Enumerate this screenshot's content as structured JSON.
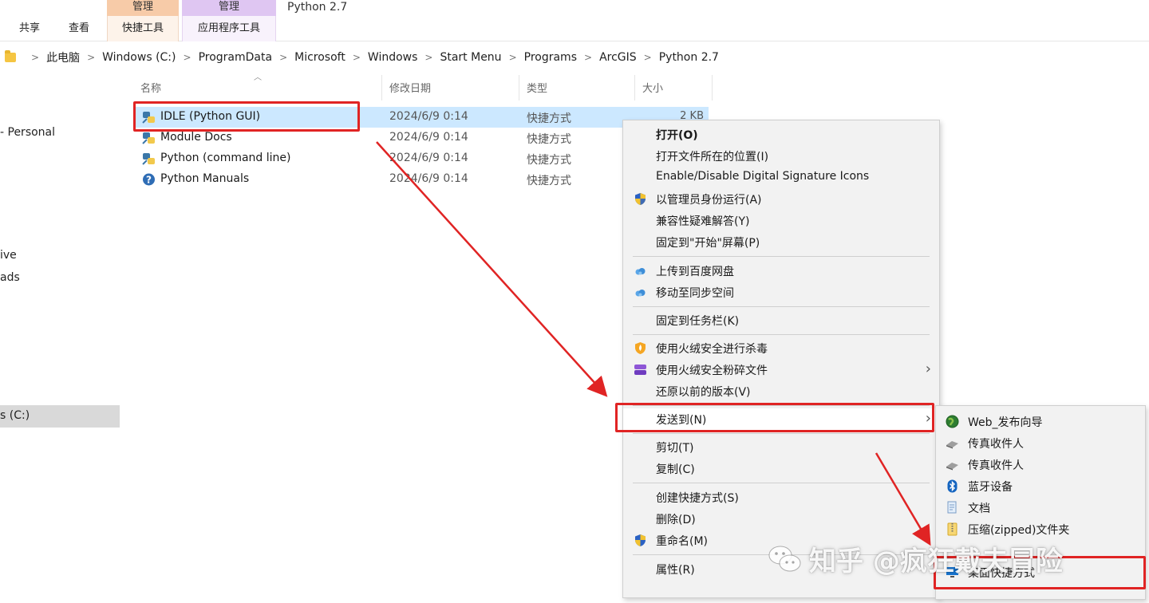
{
  "ribbon": {
    "tabs": [
      "共享",
      "查看"
    ],
    "context_groups": [
      {
        "header": "管理",
        "tab": "快捷工具"
      },
      {
        "header": "管理",
        "tab": "应用程序工具"
      }
    ],
    "window_title": "Python 2.7"
  },
  "address": {
    "crumbs": [
      "此电脑",
      "Windows (C:)",
      "ProgramData",
      "Microsoft",
      "Windows",
      "Start Menu",
      "Programs",
      "ArcGIS",
      "Python 2.7"
    ],
    "separator": ">"
  },
  "nav": {
    "fragments": [
      "- Personal",
      "ive",
      "ads",
      "s (C:)"
    ]
  },
  "columns": {
    "name": "名称",
    "date": "修改日期",
    "type": "类型",
    "size": "大小"
  },
  "files": [
    {
      "name": "IDLE (Python GUI)",
      "date": "2024/6/9 0:14",
      "type": "快捷方式",
      "size": "2 KB",
      "icon": "python-icon"
    },
    {
      "name": "Module Docs",
      "date": "2024/6/9 0:14",
      "type": "快捷方式",
      "size": "",
      "icon": "python-icon"
    },
    {
      "name": "Python (command line)",
      "date": "2024/6/9 0:14",
      "type": "快捷方式",
      "size": "",
      "icon": "python-icon"
    },
    {
      "name": "Python Manuals",
      "date": "2024/6/9 0:14",
      "type": "快捷方式",
      "size": "",
      "icon": "help-icon"
    }
  ],
  "context_menu": {
    "items": [
      {
        "label": "打开(O)",
        "bold": true,
        "icon": ""
      },
      {
        "label": "打开文件所在的位置(I)",
        "icon": ""
      },
      {
        "label": "Enable/Disable Digital Signature Icons",
        "icon": ""
      },
      {
        "label": "以管理员身份运行(A)",
        "icon": "uac-shield-icon"
      },
      {
        "label": "兼容性疑难解答(Y)",
        "icon": ""
      },
      {
        "label": "固定到\"开始\"屏幕(P)",
        "icon": ""
      },
      {
        "label": "上传到百度网盘",
        "icon": "baidu-cloud-icon"
      },
      {
        "label": "移动至同步空间",
        "icon": "baidu-cloud-icon"
      },
      {
        "label": "固定到任务栏(K)",
        "icon": ""
      },
      {
        "label": "使用火绒安全进行杀毒",
        "icon": "huorong-shield-icon"
      },
      {
        "label": "使用火绒安全粉碎文件",
        "icon": "shredder-icon",
        "submenu": true
      },
      {
        "label": "还原以前的版本(V)",
        "icon": ""
      },
      {
        "label": "发送到(N)",
        "icon": "",
        "submenu": true
      },
      {
        "label": "剪切(T)",
        "icon": ""
      },
      {
        "label": "复制(C)",
        "icon": ""
      },
      {
        "label": "创建快捷方式(S)",
        "icon": ""
      },
      {
        "label": "删除(D)",
        "icon": ""
      },
      {
        "label": "重命名(M)",
        "icon": "uac-shield-icon"
      },
      {
        "label": "属性(R)",
        "icon": ""
      }
    ]
  },
  "send_to_menu": {
    "items": [
      {
        "label": "Web_发布向导",
        "icon": "globe-icon"
      },
      {
        "label": "传真收件人",
        "icon": "fax-icon"
      },
      {
        "label": "传真收件人",
        "icon": "fax-icon"
      },
      {
        "label": "蓝牙设备",
        "icon": "bluetooth-icon"
      },
      {
        "label": "文档",
        "icon": "documents-icon"
      },
      {
        "label": "压缩(zipped)文件夹",
        "icon": "zip-folder-icon"
      },
      {
        "label": "桌面快捷方式",
        "icon": "desktop-icon"
      }
    ]
  },
  "watermark": {
    "text": "知乎 @疯狂戴夫冒险"
  },
  "colors": {
    "selection": "#cce8ff",
    "annotation": "#e02424",
    "menu_bg": "#f2f2f2",
    "manage_tab_orange": "#f7cba8",
    "manage_tab_purple": "#dfc6f2"
  }
}
